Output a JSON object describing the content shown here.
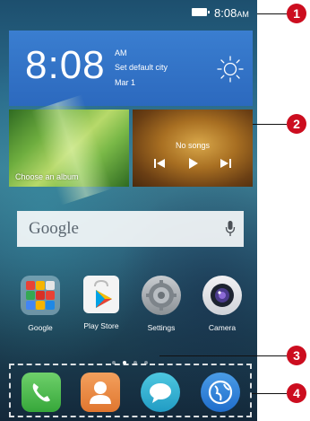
{
  "status_bar": {
    "time": "8:08",
    "ampm": "AM"
  },
  "clock_widget": {
    "time": "8:08",
    "ampm": "AM",
    "city": "Set default city",
    "date": "Mar 1"
  },
  "gallery_widget": {
    "label": "Choose an album"
  },
  "music_widget": {
    "status": "No songs"
  },
  "search_bar": {
    "logo": "Google"
  },
  "apps": [
    {
      "label": "Google"
    },
    {
      "label": "Play Store"
    },
    {
      "label": "Settings"
    },
    {
      "label": "Camera"
    }
  ],
  "page_indicator": {
    "count": 4,
    "active": 2
  },
  "dock": [
    "Phone",
    "Contacts",
    "Messaging",
    "Browser"
  ],
  "callouts": [
    "1",
    "2",
    "3",
    "4"
  ],
  "colors": {
    "callout": "#cc0d1f",
    "clock_widget": "#3274c8"
  }
}
